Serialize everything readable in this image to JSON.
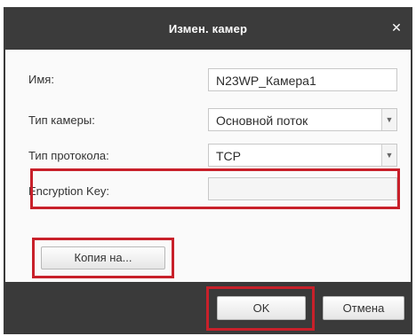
{
  "dialog": {
    "title": "Измен. камер",
    "close_glyph": "✕"
  },
  "form": {
    "name_label": "Имя:",
    "name_value": "N23WP_Камера1",
    "camera_type_label": "Тип камеры:",
    "camera_type_value": "Основной поток",
    "protocol_label": "Тип протокола:",
    "protocol_value": "TCP",
    "encryption_label": "Encryption Key:",
    "encryption_value": ""
  },
  "buttons": {
    "copy_to": "Копия на...",
    "ok": "OK",
    "cancel": "Отмена"
  },
  "icons": {
    "dropdown": "chevron-down-icon",
    "close": "close-icon"
  },
  "colors": {
    "titlebar": "#3b3b3b",
    "highlight": "#c8202a"
  }
}
